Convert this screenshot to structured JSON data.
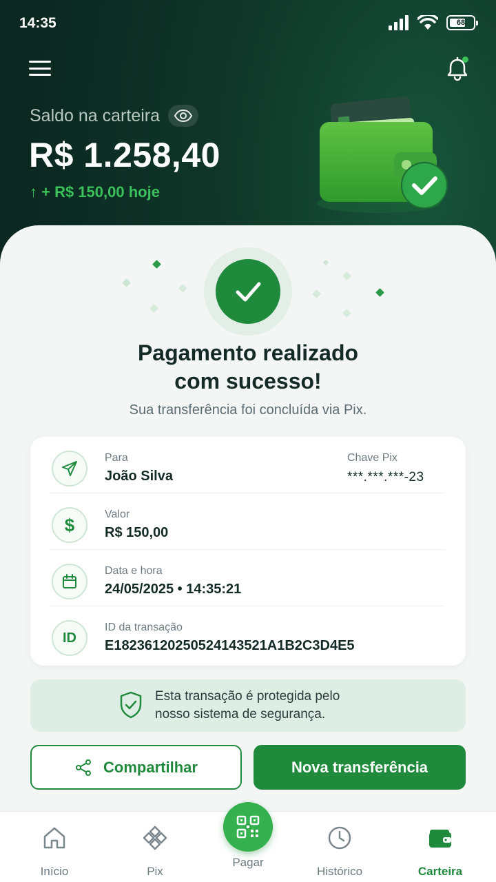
{
  "status_bar": {
    "time": "14:35",
    "battery": "68",
    "battery_level": 0.68
  },
  "header": {
    "balance_label": "Saldo na carteira",
    "balance_value": "R$ 1.258,40",
    "balance_change": "↑ + R$ 150,00 hoje"
  },
  "success": {
    "title_line1": "Pagamento realizado",
    "title_line2": "com sucesso!",
    "subtitle": "Sua transferência foi concluída via Pix."
  },
  "details": {
    "recipient_label": "Para",
    "recipient_value": "João Silva",
    "pix_key_label": "Chave Pix",
    "pix_key_value": "***.***.***-23",
    "amount_label": "Valor",
    "amount_value": "R$ 150,00",
    "datetime_label": "Data e hora",
    "datetime_value": "24/05/2025 • 14:35:21",
    "id_icon_text": "ID",
    "transaction_id_label": "ID da transação",
    "transaction_id_value": "E18236120250524143521A1B2C3D4E5"
  },
  "security": {
    "text_line1": "Esta transação é protegida pelo",
    "text_line2": "nosso sistema de segurança."
  },
  "actions": {
    "share_label": "Compartilhar",
    "new_transfer_label": "Nova transferência"
  },
  "nav": {
    "home": "Início",
    "pix": "Pix",
    "pay": "Pagar",
    "history": "Histórico",
    "wallet": "Carteira"
  },
  "colors": {
    "primary": "#1f8a3c",
    "accent_green": "#3cc05c",
    "header_bg": "#0f3528",
    "text_dark": "#142a27"
  }
}
